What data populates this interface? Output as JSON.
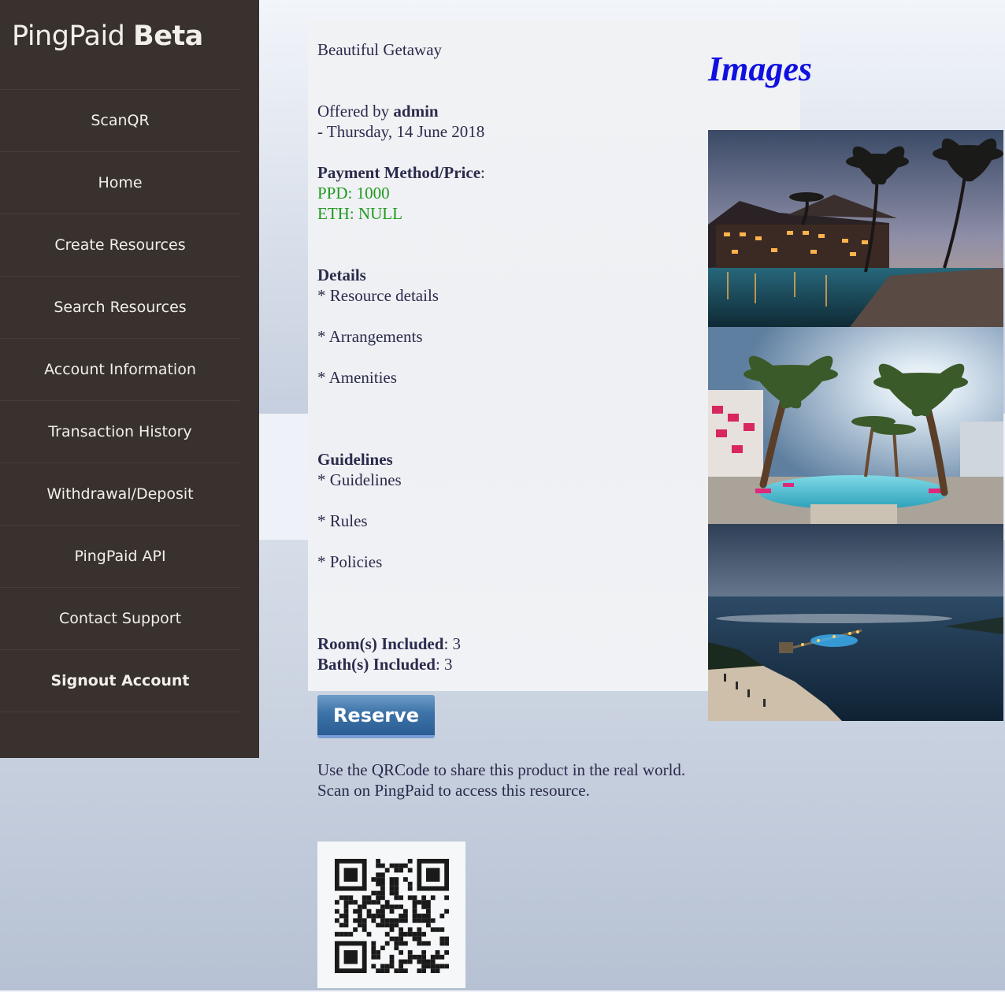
{
  "app": {
    "name": "PingPaid",
    "badge": "Beta"
  },
  "sidebar": {
    "items": [
      {
        "label": "ScanQR"
      },
      {
        "label": "Home"
      },
      {
        "label": "Create Resources"
      },
      {
        "label": "Search Resources"
      },
      {
        "label": "Account Information"
      },
      {
        "label": "Transaction History"
      },
      {
        "label": "Withdrawal/Deposit"
      },
      {
        "label": "PingPaid API"
      },
      {
        "label": "Contact Support"
      },
      {
        "label": "Signout Account"
      }
    ]
  },
  "resource": {
    "title": "Beautiful Getaway",
    "offered_prefix": "Offered by",
    "offered_by": "admin",
    "date_line": "- Thursday, 14 June 2018",
    "payment_label": "Payment Method/Price",
    "payment_colon": ":",
    "price_ppd": "PPD: 1000",
    "price_eth": "ETH: NULL",
    "details_heading": "Details",
    "details_items": [
      "* Resource details",
      "* Arrangements",
      "* Amenities"
    ],
    "guidelines_heading": "Guidelines",
    "guidelines_items": [
      "* Guidelines",
      "* Rules",
      "* Policies"
    ],
    "rooms_label": "Room(s) Included",
    "rooms_value": ": 3",
    "baths_label": "Bath(s) Included",
    "baths_value": ": 3"
  },
  "images": {
    "title": "Images"
  },
  "reserve_label": "Reserve",
  "qr": {
    "line1": "Use the QRCode to share this product in the real world.",
    "line2": "Scan on PingPaid to access this resource."
  },
  "colors": {
    "sidebar_bg": "#38312e",
    "price_green": "#1f9a1f",
    "images_title": "#1010e0",
    "button_blue": "#3d73a8"
  }
}
